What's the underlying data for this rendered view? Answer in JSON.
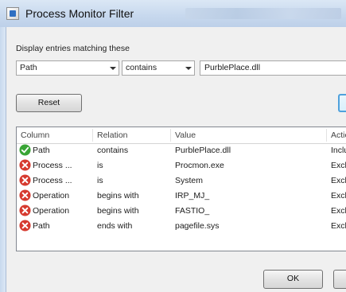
{
  "window": {
    "title": "Process Monitor Filter"
  },
  "filter": {
    "label": "Display entries matching these",
    "column_value": "Path",
    "relation_value": "contains",
    "value_text": "PurblePlace.dll"
  },
  "buttons": {
    "reset": "Reset",
    "ok": "OK"
  },
  "list": {
    "headers": [
      "Column",
      "Relation",
      "Value",
      "Action"
    ],
    "rows": [
      {
        "status": "include",
        "column": "Path",
        "relation": "contains",
        "value": "PurblePlace.dll",
        "action": "Includ"
      },
      {
        "status": "exclude",
        "column": "Process ...",
        "relation": "is",
        "value": "Procmon.exe",
        "action": "Exclu"
      },
      {
        "status": "exclude",
        "column": "Process ...",
        "relation": "is",
        "value": "System",
        "action": "Exclu"
      },
      {
        "status": "exclude",
        "column": "Operation",
        "relation": "begins with",
        "value": "IRP_MJ_",
        "action": "Exclu"
      },
      {
        "status": "exclude",
        "column": "Operation",
        "relation": "begins with",
        "value": "FASTIO_",
        "action": "Exclu"
      },
      {
        "status": "exclude",
        "column": "Path",
        "relation": "ends with",
        "value": "pagefile.sys",
        "action": "Exclu"
      }
    ]
  },
  "icons": {
    "include": "checkmark-green-icon",
    "exclude": "x-red-icon"
  },
  "colors": {
    "include_green": "#3aa536",
    "exclude_red": "#d63a2f",
    "focus_blue": "#4fa1dc"
  }
}
